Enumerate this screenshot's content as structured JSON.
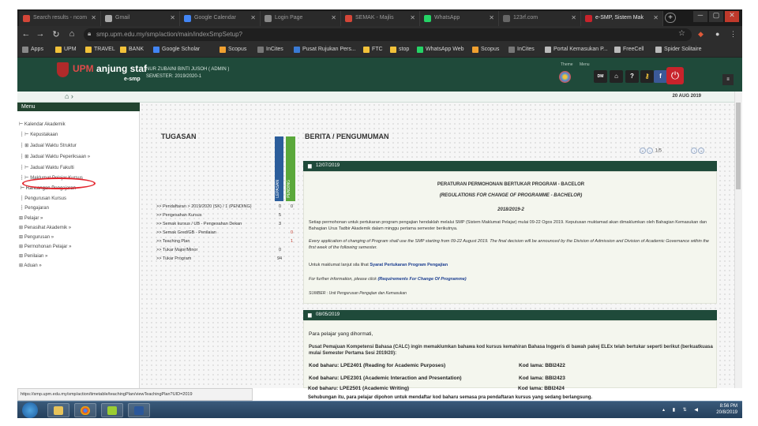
{
  "browser": {
    "tabs": [
      {
        "label": "Search results - ncom",
        "color": "#d44638"
      },
      {
        "label": "Gmail",
        "color": "#aaaaaa"
      },
      {
        "label": "Google Calendar",
        "color": "#4285f4"
      },
      {
        "label": "Login Page",
        "color": "#888888"
      },
      {
        "label": "SEMAK - Majlis",
        "color": "#d44638"
      },
      {
        "label": "WhatsApp",
        "color": "#25d366"
      },
      {
        "label": "123rf.com",
        "color": "#666666"
      },
      {
        "label": "e-SMP, Sistem Mak",
        "color": "#c8232b"
      }
    ],
    "new_tab": "+",
    "url": "smp.upm.edu.my/smp/action/main/indexSmpSetup?",
    "bookmarks": [
      {
        "label": "Apps",
        "color": "#888888"
      },
      {
        "label": "UPM",
        "color": "#f2c23a"
      },
      {
        "label": "TRAVEL",
        "color": "#f2c23a"
      },
      {
        "label": "BANK",
        "color": "#f2c23a"
      },
      {
        "label": "Google Scholar",
        "color": "#4285f4"
      },
      {
        "label": "Scopus",
        "color": "#f0a030"
      },
      {
        "label": "InCites",
        "color": "#777777"
      },
      {
        "label": "Pusat Rujukan Pers...",
        "color": "#3a7bd5"
      },
      {
        "label": "FTC",
        "color": "#f2c23a"
      },
      {
        "label": "stop",
        "color": "#f2c23a"
      },
      {
        "label": "WhatsApp Web",
        "color": "#25d366"
      },
      {
        "label": "Scopus",
        "color": "#f0a030"
      },
      {
        "label": "InCites",
        "color": "#777777"
      },
      {
        "label": "Portal Kemasukan P...",
        "color": "#bbbbbb"
      },
      {
        "label": "FreeCell",
        "color": "#bbbbbb"
      },
      {
        "label": "Spider Solitaire",
        "color": "#bbbbbb"
      }
    ]
  },
  "header": {
    "logo_upm": "UPM",
    "logo_name": "anjung staf",
    "logo_sub": "e-smp",
    "info_line1": "NUR ZUBAINI BINTI JUSOH ( ADMIN )",
    "info_line2": "SEMESTER: 2019/2020-1",
    "theme_label": "Theme",
    "menu_label": "Menu",
    "btn_dm": "DM",
    "btn_help": "?",
    "btn_facebook": "f",
    "right_btn": "≡",
    "date": "20 AUG 2019",
    "collapse": "▼"
  },
  "sidebar": {
    "title": "Menu",
    "items": [
      "Kalendar Akademik",
      "Kepustakaan",
      "Jadual Waktu Struktur",
      "Jadual Waktu Peperiksaan",
      "Jadual Waktu Fakulti",
      "Maklumat Pelajar Kursus",
      "Rancangan Pengajaran",
      "Pengurusan Kursus",
      "Pengajaran",
      "Pelajar",
      "Penasihat Akademik",
      "Pengurusan",
      "Permohonan Pelajar",
      "Penilaian",
      "Aduan"
    ]
  },
  "tugasan": {
    "title": "TUGASAN",
    "col1": "LEPASAN",
    "col2": "PENDING",
    "rows": [
      {
        "label": "Pendaftaran > 2019/2020 (SK) / 1 (PENDING)",
        "a": "0",
        "b": "0",
        "bred": false
      },
      {
        "label": "Pengesahan Kursus",
        "a": "5",
        "b": "",
        "bred": false
      },
      {
        "label": "Semak kursus / UB - Pengesahan Dekan",
        "a": "3",
        "b": "",
        "bred": false
      },
      {
        "label": "Semak Gred/GB - Penilaian",
        "a": "",
        "b": "0",
        "bred": true
      },
      {
        "label": "Teaching Plan",
        "a": "",
        "b": "1",
        "bred": true
      },
      {
        "label": "Tukar Major/Minor",
        "a": "0",
        "b": "",
        "bred": false
      },
      {
        "label": "Tukar Program",
        "a": "94",
        "b": "",
        "bred": false
      }
    ]
  },
  "berita": {
    "title": "BERITA / PENGUMUMAN",
    "page": "1/5",
    "news1": {
      "date": "12/07/2019",
      "title": "PERATURAN PERMOHONAN BERTUKAR PROGRAM - BACELOR",
      "title_en": "(REGULATIONS FOR CHANGE OF PROGRAMME - BACHELOR)",
      "session": "2018/2019-2",
      "p1": "Setiap permohonan untuk pertukaran program pengajian hendaklah melalui SMP (Sistem Maklumat Pelajar) mulai 09-22 Ogos 2019. Keputusan muktamad akan dimaklumkan oleh Bahagian Kemasukan dan Bahagian Urus Tadbir Akademik dalam minggu pertama semester berikutnya.",
      "p2": "Every application of changing of Program shall use the SMP starting from 09-22 August 2019. The final decision will be announced by the Division of Admission and Division of Academic Governance within the first week of the following semester.",
      "p3_prefix": "Untuk maklumat lanjut sila lihat",
      "p3_link": "Syarat Pertukaran Program Pengajian",
      "p4_prefix": "For further information, please click",
      "p4_link": "(Requirements For Change Of Programme)",
      "source": "SUMBER : Unit Pengurusan Pengajian dan Kemasukan"
    },
    "news2": {
      "date": "08/05/2019",
      "greeting": "Para pelajar yang dihormati,",
      "intro": "Pusat Pemajuan Kompetensi Bahasa (CALC) ingin memaklumkan bahawa kod kursus kemahiran Bahasa Inggeris di bawah pakej ELEx telah bertukar seperti berikut (berkuatkuasa mulai Semester Pertama Sesi 2019/20):",
      "codes": [
        {
          "new": "Kod baharu: LPE2401 (Reading for Academic Purposes)",
          "old": "Kod lama: BBI2422"
        },
        {
          "new": "Kod baharu: LPE2301 (Academic Interaction and Presentation)",
          "old": "Kod lama: BBI2423"
        },
        {
          "new": "Kod baharu: LPE2501 (Academic Writing)",
          "old": "Kod lama: BBI2424"
        }
      ],
      "footer": "Sehubungan itu, para pelajar dipohon untuk mendaftar kod baharu semasa pra pendaftaran kursus yang sedang berlangsung."
    }
  },
  "status_url": "https://smp.upm.edu.my/smp/action/timetable/teachingPlan/viewTeachingPlan?UID=2019",
  "taskbar": {
    "time": "8:56 PM",
    "date": "20/8/2019"
  }
}
